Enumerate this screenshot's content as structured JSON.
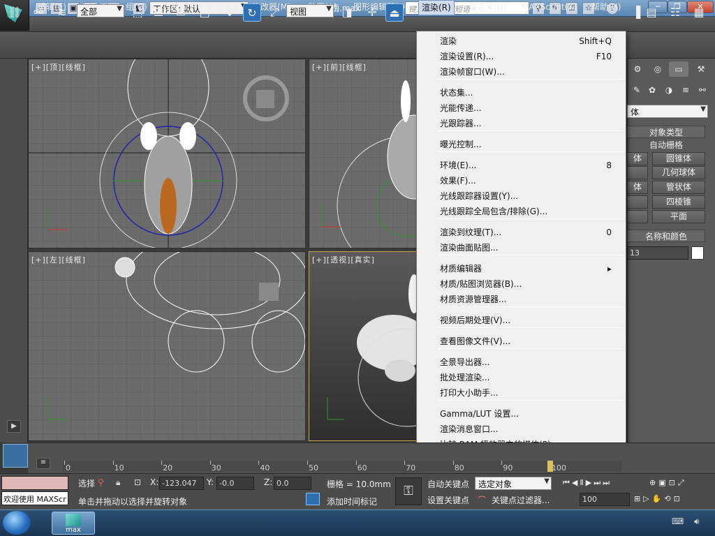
{
  "title_bar": {
    "workspace_label": "工作区: 默认",
    "filename": "小动物吃东西.max",
    "search_placeholder": "键入关键字或短语"
  },
  "menubar": {
    "items": [
      "编辑(E)",
      "工具(T)",
      "组(G)",
      "视图(V)",
      "创建(C)",
      "修改器(M)",
      "动画(A)",
      "图形编辑器(D)",
      "渲染(R)",
      "自定义(U)",
      "MAXScript(X)",
      "帮助(H)"
    ]
  },
  "toolbar": {
    "selection_filter": "全部",
    "ref_coord": "视图"
  },
  "viewports": {
    "top": "[+][顶][线框]",
    "front": "[+][前][线框]",
    "left": "[+][左][线框]",
    "persp": "[+][透视][真实]"
  },
  "render_menu": {
    "items": [
      {
        "label": "渲染",
        "shortcut": "Shift+Q"
      },
      {
        "label": "渲染设置(R)...",
        "shortcut": "F10"
      },
      {
        "label": "渲染帧窗口(W)...",
        "shortcut": ""
      },
      {
        "label": "状态集...",
        "shortcut": ""
      },
      {
        "label": "光能传递...",
        "shortcut": ""
      },
      {
        "label": "光跟踪器...",
        "shortcut": ""
      },
      {
        "label": "曝光控制...",
        "shortcut": ""
      },
      {
        "label": "环境(E)...",
        "shortcut": "8"
      },
      {
        "label": "效果(F)...",
        "shortcut": ""
      },
      {
        "label": "光线跟踪器设置(Y)...",
        "shortcut": ""
      },
      {
        "label": "光线跟踪全局包含/排除(G)...",
        "shortcut": ""
      },
      {
        "label": "渲染到纹理(T)...",
        "shortcut": "0"
      },
      {
        "label": "渲染曲面贴图...",
        "shortcut": ""
      },
      {
        "label": "材质编辑器",
        "shortcut": "▸"
      },
      {
        "label": "材质/贴图浏览器(B)...",
        "shortcut": ""
      },
      {
        "label": "材质资源管理器...",
        "shortcut": ""
      },
      {
        "label": "视频后期处理(V)...",
        "shortcut": ""
      },
      {
        "label": "查看图像文件(V)...",
        "shortcut": ""
      },
      {
        "label": "全景导出器...",
        "shortcut": ""
      },
      {
        "label": "批处理渲染...",
        "shortcut": ""
      },
      {
        "label": "打印大小助手...",
        "shortcut": ""
      },
      {
        "label": "Gamma/LUT 设置...",
        "shortcut": ""
      },
      {
        "label": "渲染消息窗口...",
        "shortcut": ""
      },
      {
        "label": "比较 RAM 播放器中的媒体(P)...",
        "shortcut": ""
      }
    ]
  },
  "command_panel": {
    "dropdown": "体",
    "object_type_title": "对象类型",
    "autogrid": "自动栅格",
    "buttons": [
      "体",
      "圆锥体",
      "",
      "几何球体",
      "体",
      "管状体",
      "",
      "四棱锥",
      "",
      "平面"
    ],
    "name_color_title": "名称和颜色",
    "name_value": "13"
  },
  "timeline": {
    "ticks": [
      "0",
      "10",
      "20",
      "30",
      "40",
      "50",
      "60",
      "70",
      "80",
      "90",
      "100"
    ]
  },
  "statusbar": {
    "welcome": "欢迎使用 MAXScr",
    "select_label": "选择",
    "x_label": "X:",
    "x_value": "-123.047",
    "y_label": "Y:",
    "y_value": "-0.0",
    "z_label": "Z:",
    "z_value": "0.0",
    "grid": "栅格 = 10.0mm",
    "prompt": "单击并拖动以选择并旋转对象",
    "add_time_tag": "添加时间标记",
    "auto_key": "自动关键点",
    "set_key": "设置关键点",
    "key_mode": "选定对象",
    "key_filter": "关键点过滤器...",
    "frame": "100"
  },
  "taskbar": {
    "app_label": "max"
  }
}
